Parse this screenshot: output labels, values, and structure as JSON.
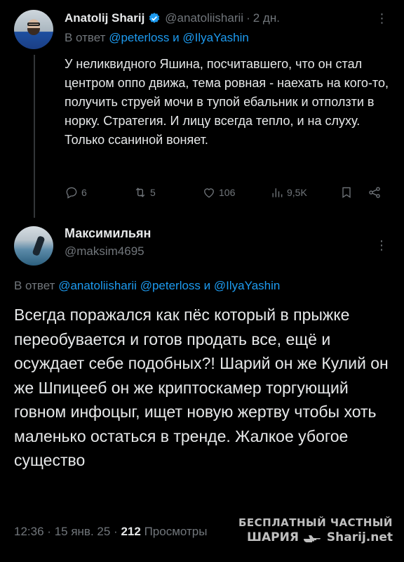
{
  "tweet1": {
    "author_name": "Anatolij Sharij",
    "handle": "@anatoliisharii",
    "separator": "·",
    "time": "2 дн.",
    "more_glyph": "⋮",
    "reply_prefix": "В ответ",
    "reply_mentions": [
      "@peterloss",
      "@IlyaYashin"
    ],
    "reply_conjunction": "и",
    "text": "У неликвидного Яшина, посчитавшего, что он стал центром оппо движа, тема ровная - наехать на кого-то, получить струей мочи в тупой ебальник и отползти в норку. Стратегия. И лицу всегда тепло, и на слуху. Только ссаниной воняет.",
    "actions": {
      "replies": "6",
      "reposts": "5",
      "likes": "106",
      "views": "9,5K"
    }
  },
  "tweet2": {
    "author_name": "Максимильян",
    "handle": "@maksim4695",
    "more_glyph": "⋮",
    "reply_prefix": "В ответ",
    "reply_mentions": [
      "@anatoliisharii",
      "@peterloss",
      "@IlyaYashin"
    ],
    "reply_conjunction": "и",
    "text": "Всегда поражался как пёс который в прыжке переобувается и готов продать все, ещё и осуждает себе подобных?! Шарий он же Кулий он же Шпицееб он же криптоскамер торгующий говном инфоцыг, ищет новую жертву чтобы хоть маленько остаться в тренде. Жалкое убогое существо",
    "time": "12:36",
    "date": "15 янв. 25",
    "separator": "·",
    "views_count": "212",
    "views_label": "Просмотры"
  },
  "watermark": {
    "line1": "БЕСПЛАТНЫЙ ЧАСТНЫЙ",
    "line2_left": "ШАРИЯ",
    "line2_right": "Sharij.net"
  },
  "colors": {
    "background": "#000000",
    "text": "#e7e9ea",
    "muted": "#71767b",
    "link": "#1d9bf0",
    "verified": "#1d9bf0"
  },
  "icons": [
    "verified-badge-icon",
    "more-icon",
    "reply-icon",
    "repost-icon",
    "like-icon",
    "views-icon",
    "bookmark-icon",
    "share-icon",
    "pointing-hand-icon"
  ]
}
